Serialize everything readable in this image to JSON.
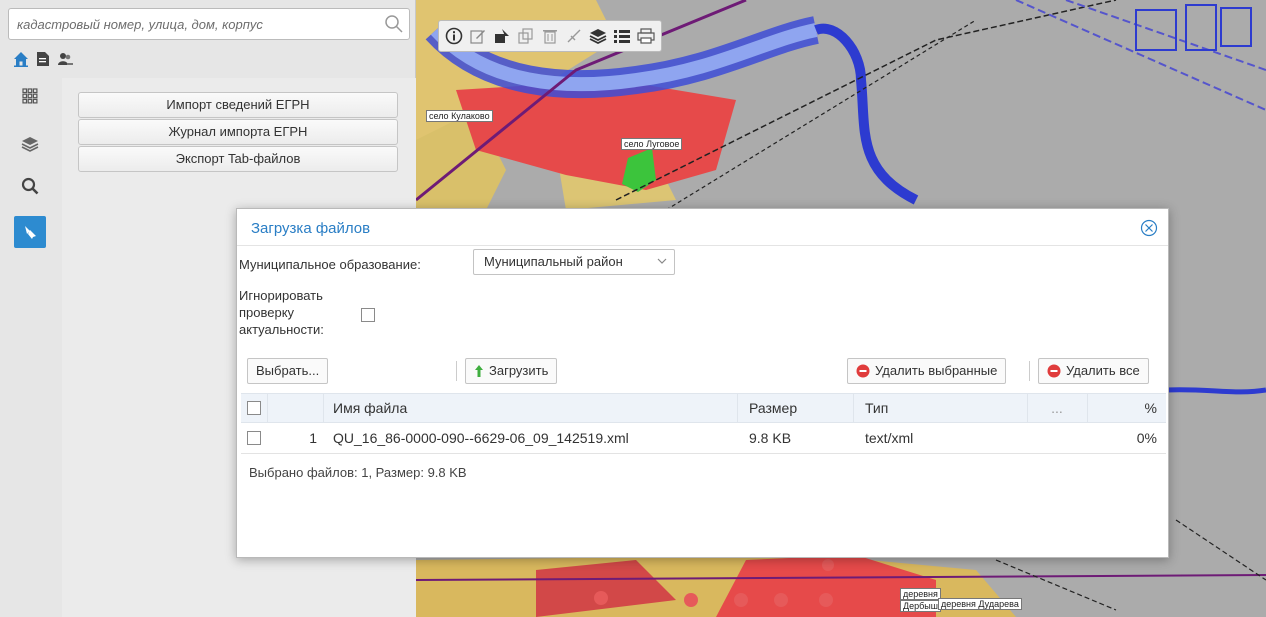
{
  "search": {
    "placeholder": "кадастровый номер, улица, дом, корпус"
  },
  "mini_toolbar": {
    "icons": [
      "home-icon",
      "document-icon",
      "users-icon"
    ]
  },
  "vertical_nav": {
    "items": [
      "grid-icon",
      "layers-icon",
      "search-icon",
      "pin-icon"
    ],
    "active_index": 3
  },
  "menu": {
    "items": [
      {
        "label": "Импорт сведений ЕГРН"
      },
      {
        "label": "Журнал импорта ЕГРН"
      },
      {
        "label": "Экспорт Tab-файлов"
      }
    ]
  },
  "map": {
    "labels": [
      "село Кулаково",
      "село Луговое",
      "деревня",
      "Дербыш",
      "деревня Дударева"
    ],
    "toolbar_icons": [
      "info-icon",
      "edit-icon",
      "measure-icon",
      "copy-icon",
      "delete-icon",
      "draw-icon",
      "layers-icon",
      "list-icon",
      "print-icon"
    ]
  },
  "dialog": {
    "title": "Загрузка файлов",
    "municipality_label": "Муниципальное образование:",
    "municipality_value": "Муниципальный район",
    "ignore_label_line1": "Игнорировать",
    "ignore_label_line2": "проверку",
    "ignore_label_line3": "актуальности:",
    "ignore_checked": false,
    "buttons": {
      "choose": "Выбрать...",
      "upload": "Загрузить",
      "delete_selected": "Удалить выбранные",
      "delete_all": "Удалить все"
    },
    "table": {
      "columns": [
        "Имя файла",
        "Размер",
        "Тип",
        "...",
        "%"
      ],
      "rows": [
        {
          "index": "1",
          "name": "QU_16_86-0000-090--6629-06_09_142519.xml",
          "size": "9.8 KB",
          "type": "text/xml",
          "extra": "",
          "percent": "0%"
        }
      ]
    },
    "summary": "Выбрано файлов: 1, Размер: 9.8 KB"
  },
  "colors": {
    "accent": "#2a7ec5",
    "active_nav": "#2d8bd0",
    "delete_red": "#e03c3c",
    "upload_green": "#3fae3f"
  }
}
